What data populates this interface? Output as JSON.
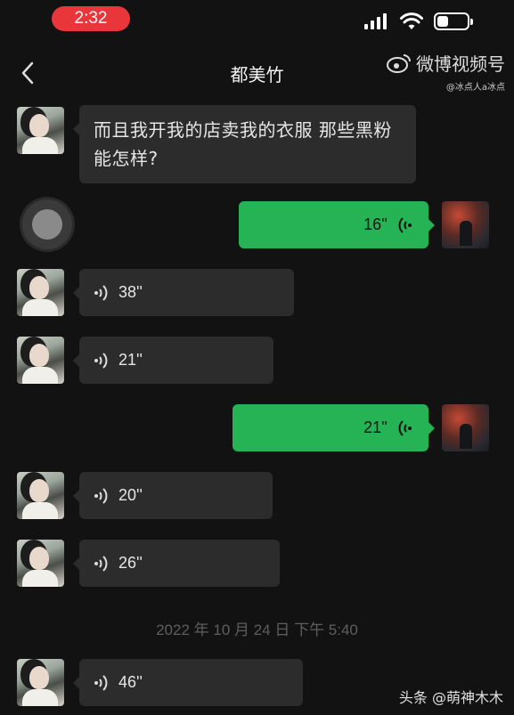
{
  "status_bar": {
    "time": "2:32"
  },
  "header": {
    "title": "都美竹"
  },
  "watermark": {
    "brand": "微博视频号",
    "handle": "@冰点人a冰点"
  },
  "messages": [
    {
      "from": "her",
      "type": "text",
      "text": "而且我开我的店卖我的衣服 那些黑粉能怎样?"
    },
    {
      "from": "me",
      "type": "voice",
      "duration": "16''"
    },
    {
      "from": "her",
      "type": "voice",
      "duration": "38''"
    },
    {
      "from": "her",
      "type": "voice",
      "duration": "21''"
    },
    {
      "from": "me",
      "type": "voice",
      "duration": "21''"
    },
    {
      "from": "her",
      "type": "voice",
      "duration": "20''"
    },
    {
      "from": "her",
      "type": "voice",
      "duration": "26''"
    },
    {
      "from": "her",
      "type": "voice",
      "duration": "46''"
    }
  ],
  "timestamp": "2022 年 10 月 24 日 下午 5:40",
  "footer_watermark": "头条 @萌神木木",
  "colors": {
    "outgoing": "#26b356",
    "incoming": "#2c2c2c",
    "background": "#121212",
    "time_pill": "#e8363a"
  },
  "icons": [
    "back-icon",
    "signal-icon",
    "wifi-icon",
    "battery-icon",
    "weibo-logo-icon",
    "voice-wave-icon"
  ]
}
